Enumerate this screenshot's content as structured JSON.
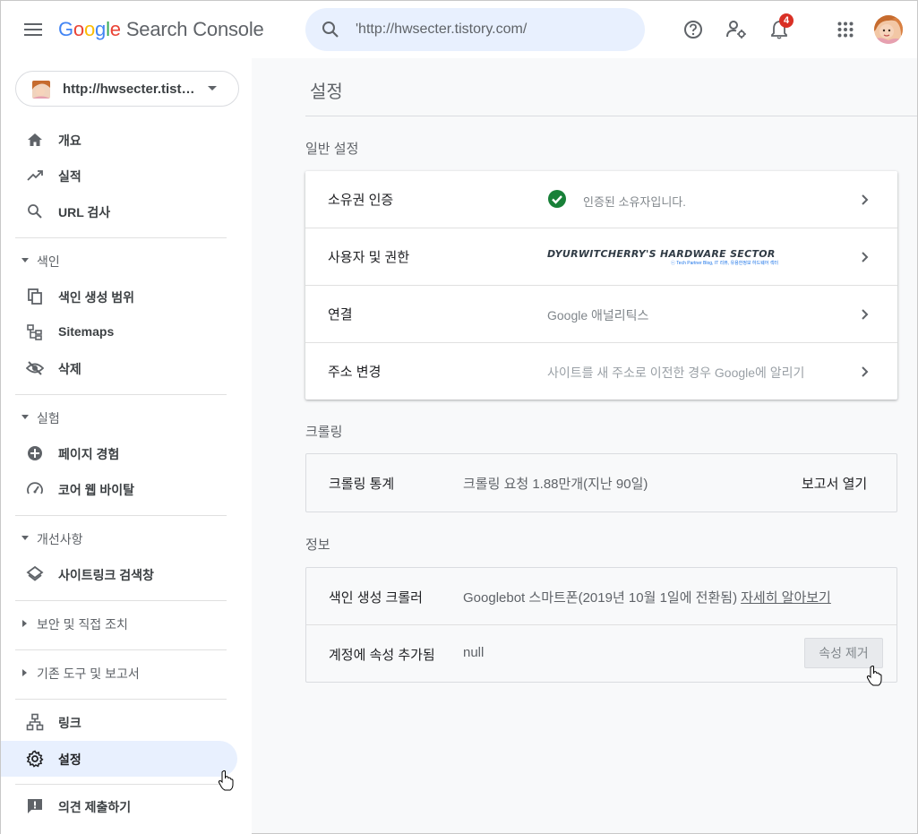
{
  "header": {
    "logo_google": [
      "G",
      "o",
      "o",
      "g",
      "l",
      "e"
    ],
    "product_name": "Search Console",
    "search_value": "'http://hwsecter.tistory.com/",
    "notification_count": "4",
    "colors": {
      "blue": "#4285f4",
      "red": "#ea4335",
      "yellow": "#fbbc05",
      "green": "#34a853",
      "search_bg": "#e8f0fe"
    }
  },
  "sidebar": {
    "property": "http://hwsecter.tistory.com/",
    "items": [
      {
        "label": "개요",
        "icon": "home-icon"
      },
      {
        "label": "실적",
        "icon": "trending-up-icon"
      },
      {
        "label": "URL 검사",
        "icon": "search-icon"
      }
    ],
    "sections": {
      "index": {
        "title": "색인",
        "items": [
          {
            "label": "색인 생성 범위",
            "icon": "copy-icon"
          },
          {
            "label": "Sitemaps",
            "icon": "sitemap-icon"
          },
          {
            "label": "삭제",
            "icon": "eye-off-icon"
          }
        ]
      },
      "experience": {
        "title": "실험",
        "items": [
          {
            "label": "페이지 경험",
            "icon": "plus-circle-icon"
          },
          {
            "label": "코어 웹 바이탈",
            "icon": "speedometer-icon"
          }
        ]
      },
      "enhancements": {
        "title": "개선사항",
        "items": [
          {
            "label": "사이트링크 검색창",
            "icon": "layers-icon"
          }
        ]
      },
      "security": {
        "title": "보안 및 직접 조치"
      },
      "legacy": {
        "title": "기존 도구 및 보고서"
      }
    },
    "bottom_items": [
      {
        "label": "링크",
        "icon": "network-icon"
      },
      {
        "label": "설정",
        "icon": "gear-icon",
        "active": true
      }
    ],
    "feedback": {
      "label": "의견 제출하기",
      "icon": "feedback-icon"
    }
  },
  "main": {
    "title": "설정",
    "general": {
      "title": "일반 설정",
      "rows": [
        {
          "label": "소유권 인증",
          "value": "인증된 소유자입니다."
        },
        {
          "label": "사용자 및 권한",
          "brand": "DYURWITCHERRY'S HARDWARE SECTOR",
          "brand_sub": "ⓒ Tech Partner Blog, IT 리뷰, 유용한정보 하드웨어 섹터"
        },
        {
          "label": "연결",
          "value": "Google 애널리틱스"
        },
        {
          "label": "주소 변경",
          "value": "사이트를 새 주소로 이전한 경우 Google에 알리기"
        }
      ]
    },
    "crawling": {
      "title": "크롤링",
      "label": "크롤링 통계",
      "value": "크롤링 요청 1.88만개(지난 90일)",
      "link": "보고서 열기"
    },
    "about": {
      "title": "정보",
      "crawler_label": "색인 생성 크롤러",
      "crawler_value": "Googlebot 스마트폰(2019년 10월 1일에 전환됨)",
      "crawler_link": "자세히 알아보기",
      "added_label": "계정에 속성 추가됨",
      "added_value": "null",
      "remove_button": "속성 제거"
    }
  }
}
